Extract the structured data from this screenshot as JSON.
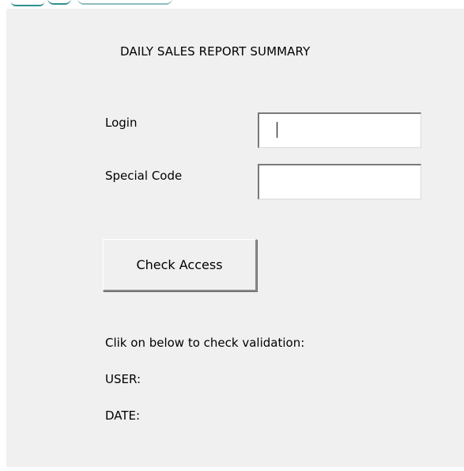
{
  "form": {
    "title": "DAILY SALES REPORT SUMMARY",
    "login_label": "Login",
    "login_value": "",
    "special_code_label": "Special Code",
    "special_code_value": "",
    "check_button_label": "Check Access"
  },
  "info": {
    "hint": "Clik on below to check validation:",
    "user_label": "USER:",
    "date_label": "DATE:"
  },
  "colors": {
    "panel_background": "#f0f0f0",
    "field_background": "#ffffff"
  }
}
